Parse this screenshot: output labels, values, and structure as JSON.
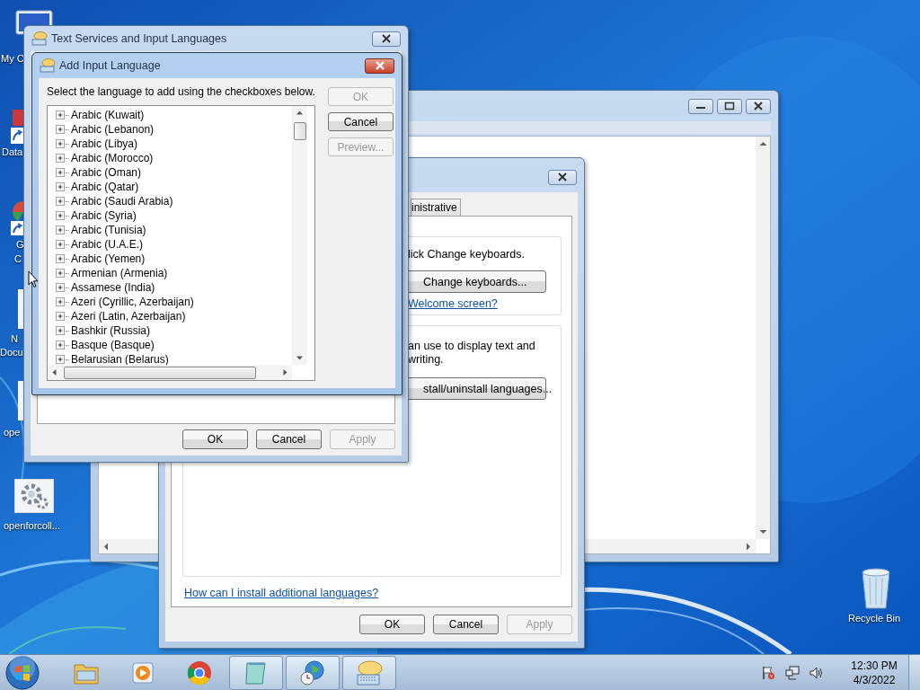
{
  "desktop": {
    "icons": [
      {
        "lines": [
          "My C"
        ]
      },
      {
        "lines": [
          "Data"
        ]
      },
      {
        "lines": [
          "G",
          "C"
        ]
      },
      {
        "lines": [
          "N",
          "Docu"
        ]
      },
      {
        "lines": [
          "ope"
        ]
      },
      {
        "lines": [
          "openforcoll..."
        ]
      }
    ],
    "recycle_bin": {
      "label": "Recycle Bin"
    }
  },
  "region_dialog": {
    "tab": {
      "label": "inistrative",
      "selected": false
    },
    "keyboards_text": "lick Change keyboards.",
    "keyboards_button": "Change keyboards...",
    "welcome_link": "Welcome screen?",
    "display_lines": [
      "an use to display text and",
      "writing."
    ],
    "install_button": "stall/uninstall languages...",
    "help_link": "How can I install additional languages?",
    "buttons": [
      {
        "label": "OK",
        "disabled": false
      },
      {
        "label": "Cancel",
        "disabled": false
      },
      {
        "label": "Apply",
        "disabled": true
      }
    ]
  },
  "text_services": {
    "title": "Text Services and Input Languages",
    "buttons": [
      {
        "label": "OK",
        "disabled": false
      },
      {
        "label": "Cancel",
        "disabled": false
      },
      {
        "label": "Apply",
        "disabled": true
      }
    ]
  },
  "add_input_language": {
    "title": "Add Input Language",
    "instruction": "Select the language to add using the checkboxes below.",
    "languages": [
      {
        "label": "Arabic (Kuwait)",
        "expanded": false
      },
      {
        "label": "Arabic (Lebanon)",
        "expanded": false
      },
      {
        "label": "Arabic (Libya)",
        "expanded": false
      },
      {
        "label": "Arabic (Morocco)",
        "expanded": false
      },
      {
        "label": "Arabic (Oman)",
        "expanded": false
      },
      {
        "label": "Arabic (Qatar)",
        "expanded": false
      },
      {
        "label": "Arabic (Saudi Arabia)",
        "expanded": false
      },
      {
        "label": "Arabic (Syria)",
        "expanded": false
      },
      {
        "label": "Arabic (Tunisia)",
        "expanded": false
      },
      {
        "label": "Arabic (U.A.E.)",
        "expanded": false
      },
      {
        "label": "Arabic (Yemen)",
        "expanded": false
      },
      {
        "label": "Armenian (Armenia)",
        "expanded": false
      },
      {
        "label": "Assamese (India)",
        "expanded": false
      },
      {
        "label": "Azeri (Cyrillic, Azerbaijan)",
        "expanded": false
      },
      {
        "label": "Azeri (Latin, Azerbaijan)",
        "expanded": false
      },
      {
        "label": "Bashkir (Russia)",
        "expanded": false
      },
      {
        "label": "Basque (Basque)",
        "expanded": false
      },
      {
        "label": "Belarusian (Belarus)",
        "expanded": false
      }
    ],
    "buttons": [
      {
        "label": "OK",
        "disabled": true
      },
      {
        "label": "Cancel",
        "disabled": false
      },
      {
        "label": "Preview...",
        "disabled": true
      }
    ]
  },
  "taskbar": {
    "items": [
      {
        "running": false
      },
      {
        "running": false
      },
      {
        "running": false
      },
      {
        "running": true
      },
      {
        "running": true
      },
      {
        "running": true
      }
    ],
    "clock": {
      "time": "12:30 PM",
      "date": "4/3/2022"
    }
  }
}
